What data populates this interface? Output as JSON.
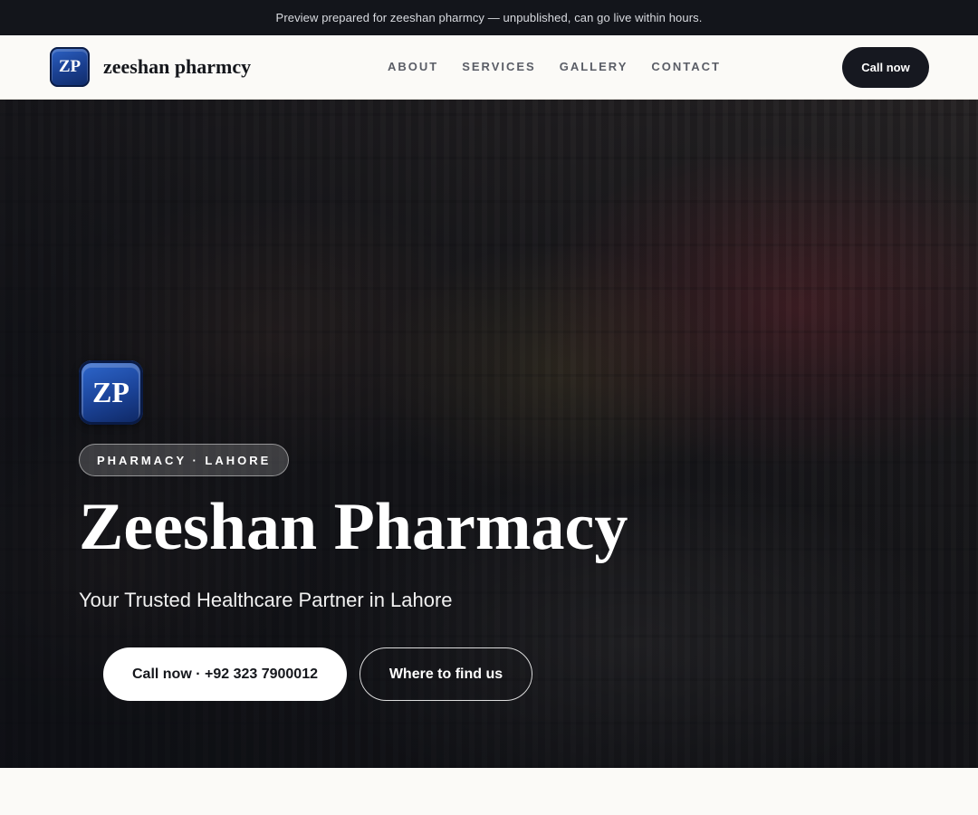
{
  "banner": {
    "text": "Preview prepared for zeeshan pharmcy — unpublished, can go live within hours."
  },
  "header": {
    "logo_initials": "ZP",
    "brand_name": "zeeshan pharmcy",
    "nav": [
      "ABOUT",
      "SERVICES",
      "GALLERY",
      "CONTACT"
    ],
    "cta_label": "Call now"
  },
  "hero": {
    "logo_initials": "ZP",
    "eyebrow": "PHARMACY · LAHORE",
    "title": "Zeeshan Pharmacy",
    "subtitle": "Your Trusted Healthcare Partner in Lahore",
    "primary_button": "Call now · +92 323 7900012",
    "secondary_button": "Where to find us",
    "background_image": "pharmacy-shelves-photo"
  },
  "colors": {
    "banner_bg": "#13151b",
    "page_bg": "#fbfaf7",
    "dark_button": "#161820",
    "logo_blue": "#1a3f8f"
  }
}
